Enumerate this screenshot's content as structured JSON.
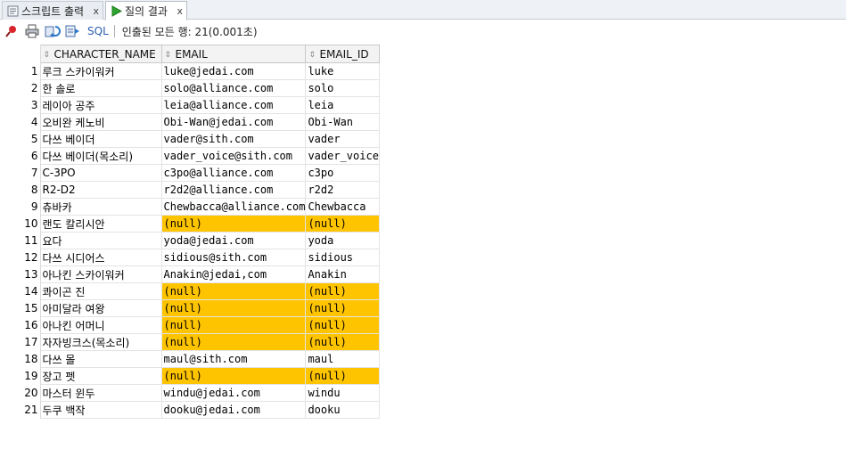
{
  "tabs": [
    {
      "label": "스크립트 출력",
      "icon": "script-output-icon",
      "active": false
    },
    {
      "label": "질의 결과",
      "icon": "run-query-icon",
      "active": true
    }
  ],
  "tab_close_glyph": "x",
  "toolbar": {
    "sql_label": "SQL",
    "status": "인출된 모든 행: 21(0.001초)",
    "icons": [
      "pin-icon",
      "print-icon",
      "refresh-icon",
      "export-icon"
    ]
  },
  "grid": {
    "columns": [
      "CHARACTER_NAME",
      "EMAIL",
      "EMAIL_ID"
    ],
    "null_color": "#ffc400",
    "rows": [
      {
        "n": "1",
        "name": "루크 스카이워커",
        "email": "luke@jedai.com",
        "email_id": "luke",
        "null": false
      },
      {
        "n": "2",
        "name": "한 솔로",
        "email": "solo@alliance.com",
        "email_id": "solo",
        "null": false
      },
      {
        "n": "3",
        "name": "레이아 공주",
        "email": "leia@alliance.com",
        "email_id": "leia",
        "null": false
      },
      {
        "n": "4",
        "name": "오비완 케노비",
        "email": "Obi-Wan@jedai.com",
        "email_id": "Obi-Wan",
        "null": false
      },
      {
        "n": "5",
        "name": "다쓰 베이더",
        "email": "vader@sith.com",
        "email_id": "vader",
        "null": false
      },
      {
        "n": "6",
        "name": "다쓰 베이더(목소리)",
        "email": "vader_voice@sith.com",
        "email_id": "vader_voice",
        "null": false
      },
      {
        "n": "7",
        "name": "C-3PO",
        "email": "c3po@alliance.com",
        "email_id": "c3po",
        "null": false
      },
      {
        "n": "8",
        "name": "R2-D2",
        "email": "r2d2@alliance.com",
        "email_id": "r2d2",
        "null": false
      },
      {
        "n": "9",
        "name": "츄바카",
        "email": "Chewbacca@alliance.com",
        "email_id": "Chewbacca",
        "null": false
      },
      {
        "n": "10",
        "name": "랜도 칼리시안",
        "email": "(null)",
        "email_id": "(null)",
        "null": true
      },
      {
        "n": "11",
        "name": "요다",
        "email": "yoda@jedai.com",
        "email_id": "yoda",
        "null": false
      },
      {
        "n": "12",
        "name": "다쓰 시디어스",
        "email": "sidious@sith.com",
        "email_id": "sidious",
        "null": false
      },
      {
        "n": "13",
        "name": "아나킨 스카이워커",
        "email": "Anakin@jedai,com",
        "email_id": "Anakin",
        "null": false
      },
      {
        "n": "14",
        "name": "콰이곤 진",
        "email": "(null)",
        "email_id": "(null)",
        "null": true
      },
      {
        "n": "15",
        "name": "아미달라 여왕",
        "email": "(null)",
        "email_id": "(null)",
        "null": true
      },
      {
        "n": "16",
        "name": "아나킨 어머니",
        "email": "(null)",
        "email_id": "(null)",
        "null": true
      },
      {
        "n": "17",
        "name": "자자빙크스(목소리)",
        "email": "(null)",
        "email_id": "(null)",
        "null": true
      },
      {
        "n": "18",
        "name": "다쓰 몰",
        "email": "maul@sith.com",
        "email_id": "maul",
        "null": false
      },
      {
        "n": "19",
        "name": "장고 펫",
        "email": "(null)",
        "email_id": "(null)",
        "null": true
      },
      {
        "n": "20",
        "name": "마스터 윈두",
        "email": "windu@jedai.com",
        "email_id": "windu",
        "null": false
      },
      {
        "n": "21",
        "name": "두쿠 백작",
        "email": "dooku@jedai.com",
        "email_id": "dooku",
        "null": false
      }
    ]
  }
}
